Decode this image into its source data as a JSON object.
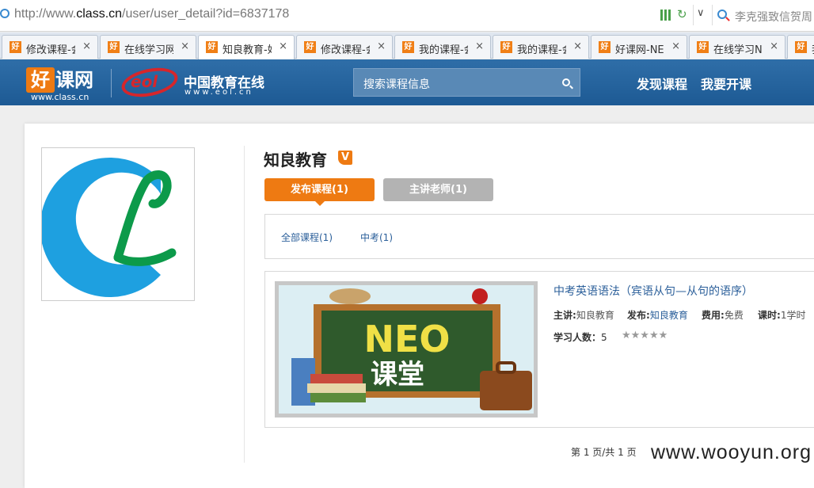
{
  "browser": {
    "url_prefix": "http://www.",
    "url_domain": "class.cn",
    "url_path": "/user/user_detail?id=6837178",
    "search_text": "李克强致信贺周",
    "tabs": [
      {
        "label": "修改课程-会",
        "active": false
      },
      {
        "label": "在线学习网:",
        "active": false
      },
      {
        "label": "知良教育-好",
        "active": true
      },
      {
        "label": "修改课程-会",
        "active": false
      },
      {
        "label": "我的课程-会",
        "active": false
      },
      {
        "label": "我的课程-会",
        "active": false
      },
      {
        "label": "好课网-NEC",
        "active": false
      },
      {
        "label": "在线学习NE",
        "active": false
      },
      {
        "label": "我",
        "active": false
      }
    ],
    "tab_icon": "好",
    "tab_close": "×"
  },
  "header": {
    "logo_hao": "好",
    "logo_rest": "课网",
    "logo_domain": "www.class.cn",
    "eol_mark": "eol",
    "eol_name": "中国教育在线",
    "eol_domain": "www.eol.cn",
    "search_placeholder": "搜索课程信息",
    "nav_discover": "发现课程",
    "nav_teach": "我要开课"
  },
  "profile": {
    "name": "知良教育",
    "verified_badge": "V",
    "tab_courses": "发布课程(1)",
    "tab_teachers": "主讲老师(1)",
    "filter_all": "全部课程(1)",
    "filter_zhongkao": "中考(1)"
  },
  "course": {
    "title": "中考英语语法（宾语从句—从句的语序）",
    "teacher_label": "主讲:",
    "teacher": "知良教育",
    "publisher_label": "发布:",
    "publisher": "知良教育",
    "fee_label": "费用:",
    "fee": "免费",
    "hours_label": "课时:",
    "hours": "1学时",
    "students_label": "学习人数：",
    "students": "5",
    "rating_stars": "★★★★★",
    "thumb_line1": "NEO",
    "thumb_line2": "课堂"
  },
  "pager": "第 1 页/共 1 页",
  "watermark": "www.wooyun.org"
}
